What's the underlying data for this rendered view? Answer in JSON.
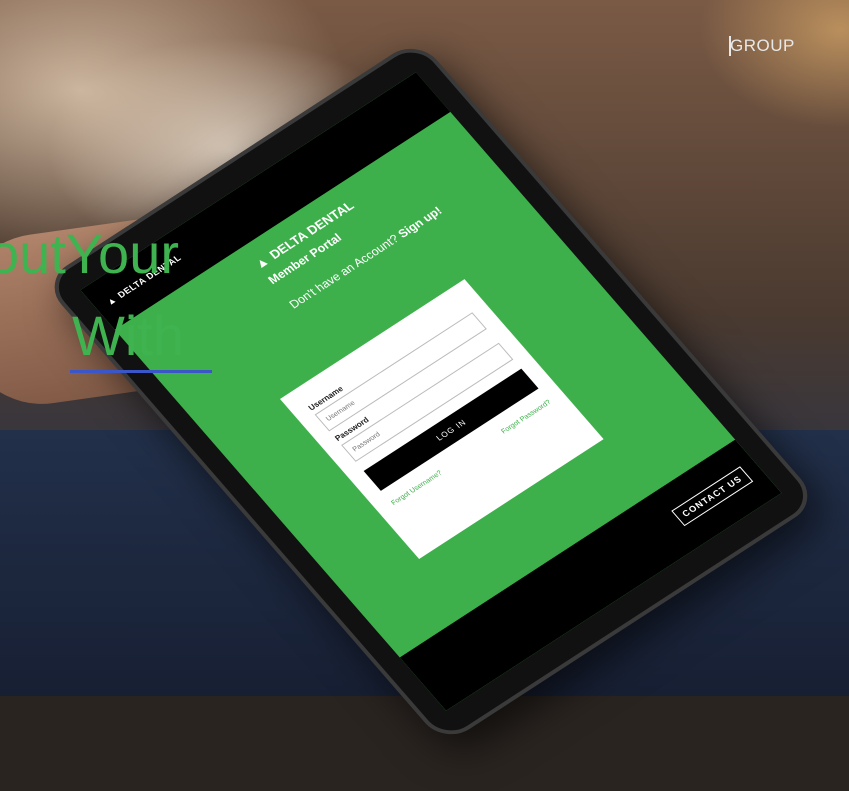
{
  "header": {
    "group_label": "GROUP"
  },
  "overlay": {
    "line1": "outYour",
    "line2": "With"
  },
  "tablet": {
    "top_logo": "DELTA DENTAL",
    "contact_label": "CONTACT US",
    "portal": {
      "logo": "DELTA DENTAL",
      "title": "Member Portal",
      "signup_prefix": "Don't have an Account? ",
      "signup_link": "Sign up!"
    },
    "login": {
      "username_label": "Username",
      "username_placeholder": "Username",
      "password_label": "Password",
      "password_placeholder": "Password",
      "button_label": "LOG IN",
      "forgot_username": "Forgot Username?",
      "forgot_password": "Forgot Password?"
    }
  },
  "colors": {
    "brand_green": "#3db04b",
    "underline_blue": "#3a56c8"
  }
}
